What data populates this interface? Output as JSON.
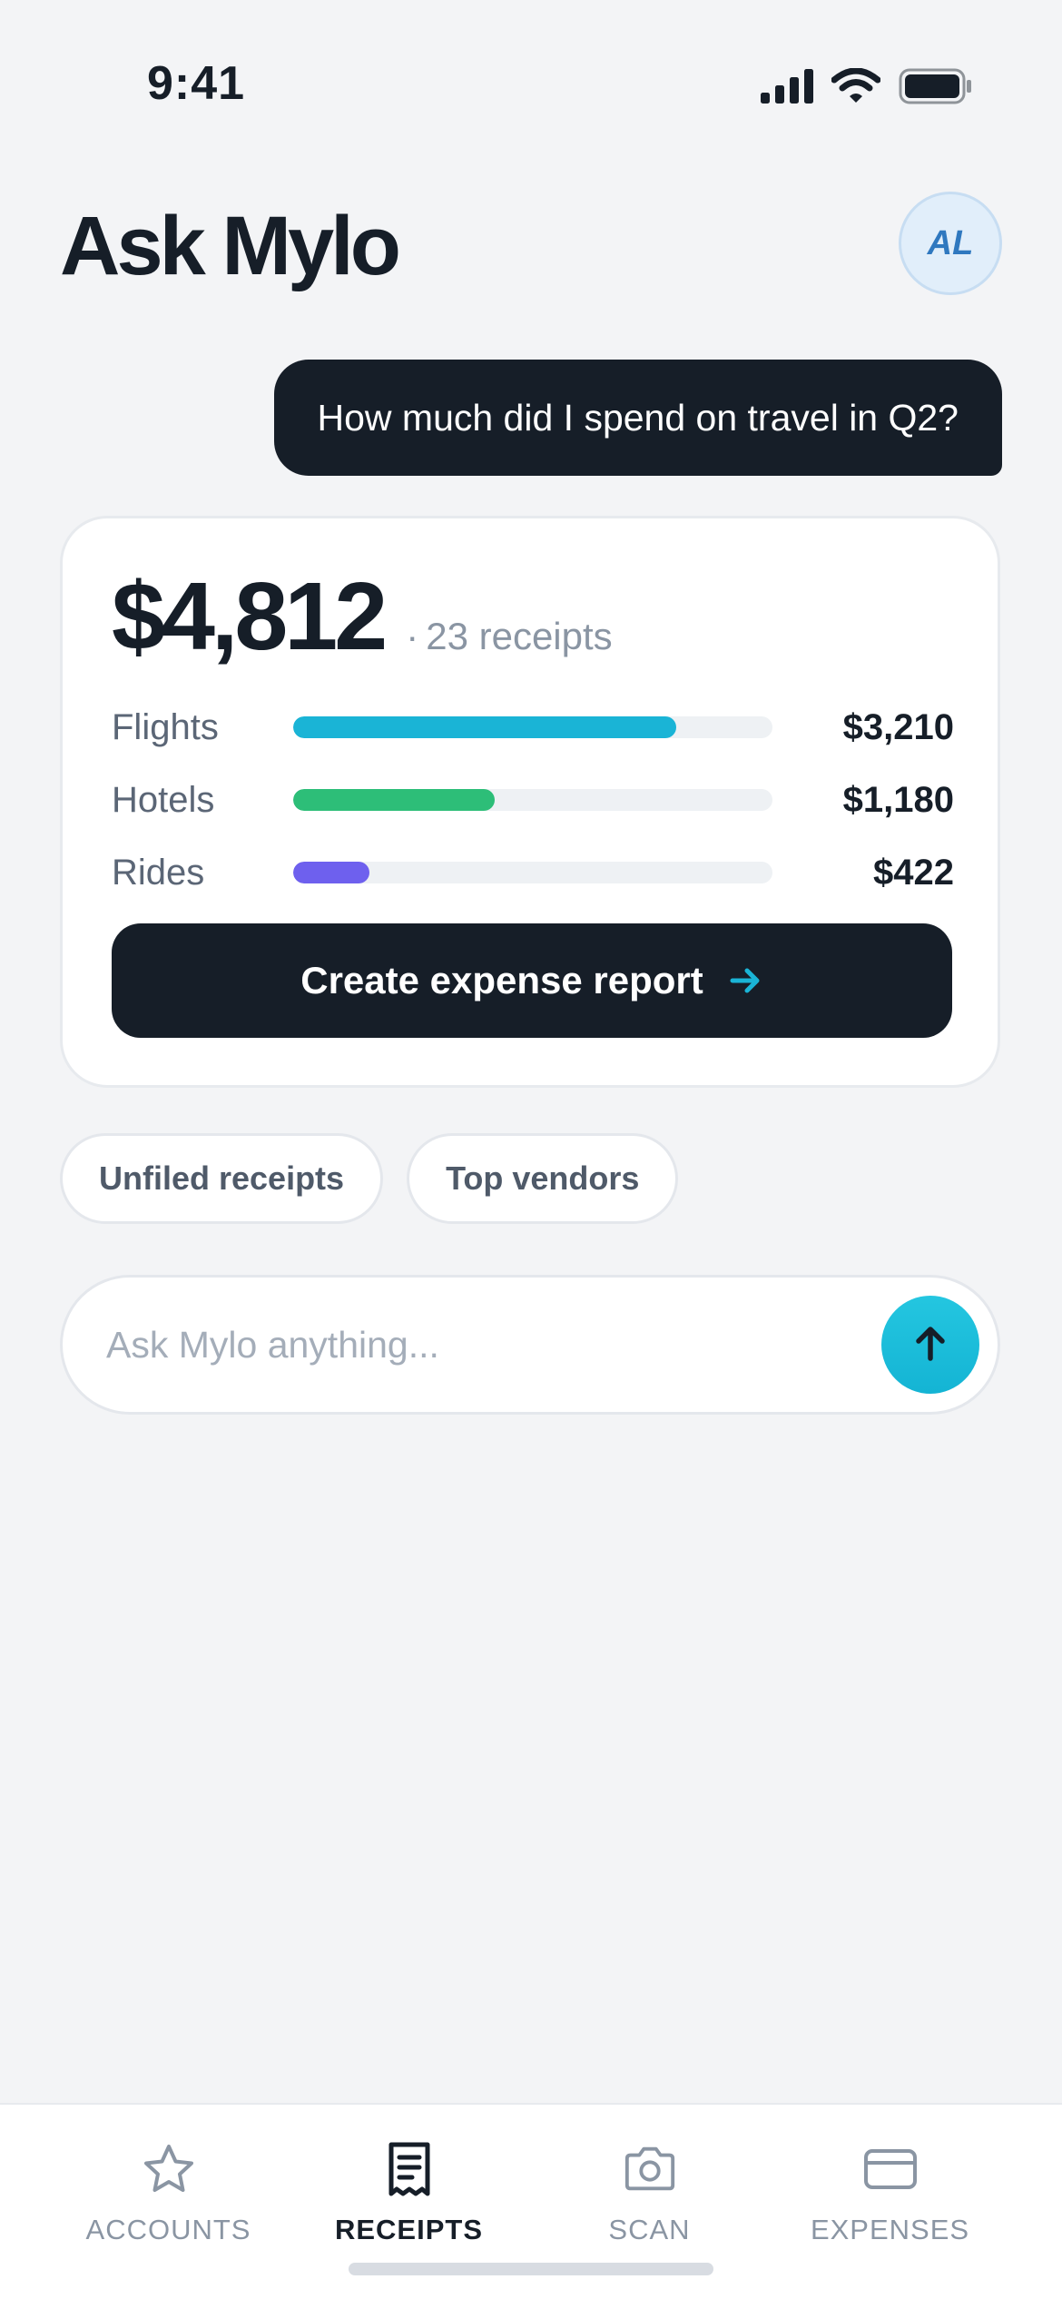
{
  "status_bar": {
    "time": "9:41"
  },
  "header": {
    "title": "Ask Mylo",
    "avatar_initials": "AL"
  },
  "conversation": {
    "user_message": "How much did I spend on travel in Q2?"
  },
  "answer": {
    "total": "$4,812",
    "separator": "·",
    "receipt_count": "23 receipts",
    "breakdown": [
      {
        "label": "Flights",
        "value": "$3,210",
        "fill_fraction": 0.8,
        "color": "#1AB4D6"
      },
      {
        "label": "Hotels",
        "value": "$1,180",
        "fill_fraction": 0.42,
        "color": "#2DBE78"
      },
      {
        "label": "Rides",
        "value": "$422",
        "fill_fraction": 0.16,
        "color": "#6E60EE"
      }
    ],
    "action_label": "Create expense report"
  },
  "suggestions": [
    {
      "label": "Unfiled receipts"
    },
    {
      "label": "Top vendors"
    }
  ],
  "composer": {
    "placeholder": "Ask Mylo anything...",
    "value": ""
  },
  "tabs": [
    {
      "label": "ACCOUNTS",
      "icon": "star-icon",
      "active": false
    },
    {
      "label": "RECEIPTS",
      "icon": "receipt-icon",
      "active": true
    },
    {
      "label": "SCAN",
      "icon": "camera-icon",
      "active": false
    },
    {
      "label": "EXPENSES",
      "icon": "card-icon",
      "active": false
    }
  ],
  "colors": {
    "ink": "#161E28",
    "accent": "#1AB4D6",
    "background": "#F3F4F6",
    "muted": "#8A95A3"
  }
}
